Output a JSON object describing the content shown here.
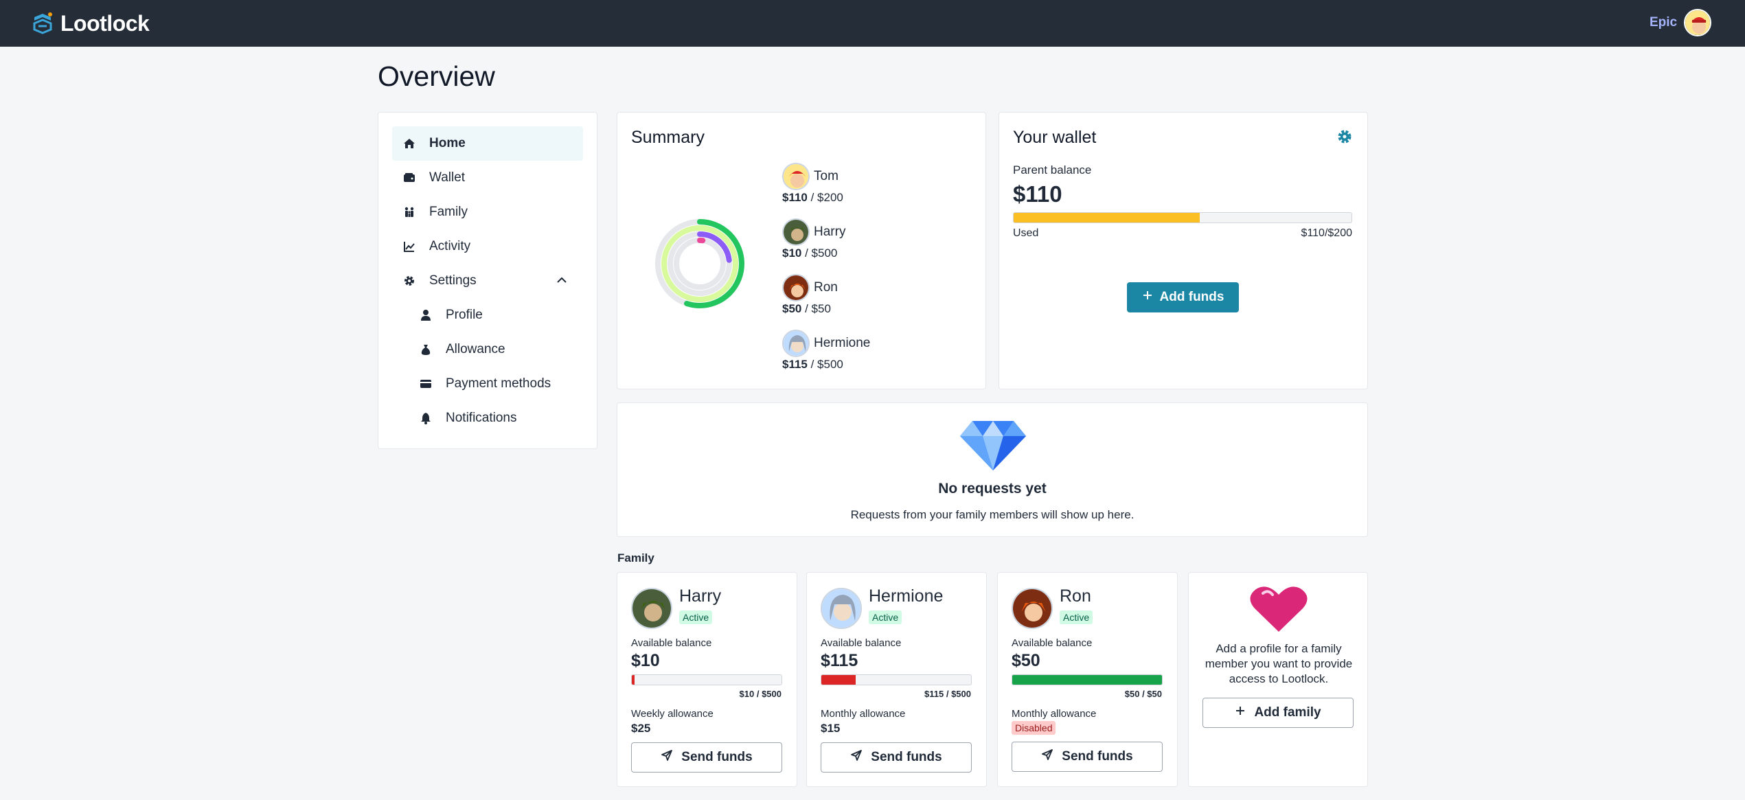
{
  "app": {
    "name": "Lootlock",
    "user_name": "Epic"
  },
  "page": {
    "title": "Overview"
  },
  "sidebar": {
    "items": [
      {
        "label": "Home",
        "icon": "home-icon"
      },
      {
        "label": "Wallet",
        "icon": "wallet-icon"
      },
      {
        "label": "Family",
        "icon": "family-icon"
      },
      {
        "label": "Activity",
        "icon": "activity-chart-icon"
      },
      {
        "label": "Settings",
        "icon": "gear-icon"
      }
    ],
    "sub_items": [
      {
        "label": "Profile",
        "icon": "user-icon"
      },
      {
        "label": "Allowance",
        "icon": "money-bag-icon"
      },
      {
        "label": "Payment methods",
        "icon": "credit-card-icon"
      },
      {
        "label": "Notifications",
        "icon": "bell-icon"
      }
    ]
  },
  "summary": {
    "title": "Summary",
    "members": [
      {
        "name": "Tom",
        "amount": "$110",
        "limit": " / $200",
        "fraction": 0.55,
        "color": "#22c55e"
      },
      {
        "name": "Harry",
        "amount": "$10",
        "limit": " / $500",
        "fraction": 0.02,
        "color": "#ec4899"
      },
      {
        "name": "Ron",
        "amount": "$50",
        "limit": " / $50",
        "fraction": 1.0,
        "color": "#d9f99d"
      },
      {
        "name": "Hermione",
        "amount": "$115",
        "limit": " / $500",
        "fraction": 0.23,
        "color": "#8b5cf6"
      }
    ]
  },
  "wallet": {
    "title": "Your wallet",
    "balance_label": "Parent balance",
    "balance": "$110",
    "used_label": "Used",
    "ratio": "$110/$200",
    "used_fraction": 0.55,
    "add_funds_label": "Add funds"
  },
  "requests": {
    "title": "No requests yet",
    "text": "Requests from your family members will show up here."
  },
  "family": {
    "heading": "Family",
    "members": [
      {
        "name": "Harry",
        "status": "Active",
        "balance_label": "Available balance",
        "balance": "$10",
        "ratio": "$10 / $500",
        "fraction": 0.02,
        "bar_color": "#dc2626",
        "allowance_label": "Weekly allowance",
        "allowance": "$25",
        "send_label": "Send funds"
      },
      {
        "name": "Hermione",
        "status": "Active",
        "balance_label": "Available balance",
        "balance": "$115",
        "ratio": "$115 / $500",
        "fraction": 0.23,
        "bar_color": "#dc2626",
        "allowance_label": "Monthly allowance",
        "allowance": "$15",
        "send_label": "Send funds"
      },
      {
        "name": "Ron",
        "status": "Active",
        "balance_label": "Available balance",
        "balance": "$50",
        "ratio": "$50 / $50",
        "fraction": 1.0,
        "bar_color": "#16a34a",
        "allowance_label": "Monthly allowance",
        "allowance": "Disabled",
        "send_label": "Send funds"
      }
    ],
    "add_text": "Add a profile for a family member you want to provide access to Lootlock.",
    "add_label": "Add family"
  },
  "colors": {
    "accent": "#1c87a5",
    "topbar": "#252d38",
    "wallet_bar": "#fbbf24"
  }
}
